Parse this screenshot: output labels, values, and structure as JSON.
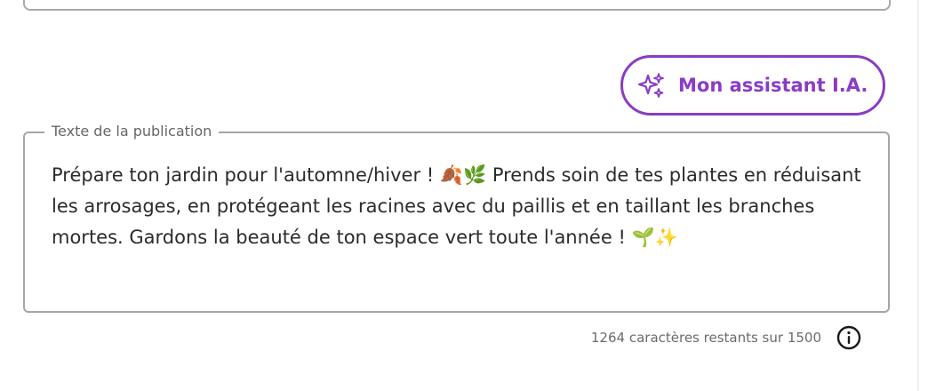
{
  "ai_assistant": {
    "label": "Mon assistant I.A.",
    "icon": "sparkles-icon",
    "color": "#8a3cc4"
  },
  "post_field": {
    "label": "Texte de la publication",
    "value": "Prépare ton jardin pour l'automne/hiver ! 🍂🌿 Prends soin de tes plantes en réduisant les arrosages, en protégeant les racines avec du paillis et en taillant les branches mortes. Gardons la beauté de ton espace vert toute l'année ! 🌱✨"
  },
  "counter": {
    "text": "1264 caractères restants sur 1500",
    "icon": "info-icon"
  }
}
